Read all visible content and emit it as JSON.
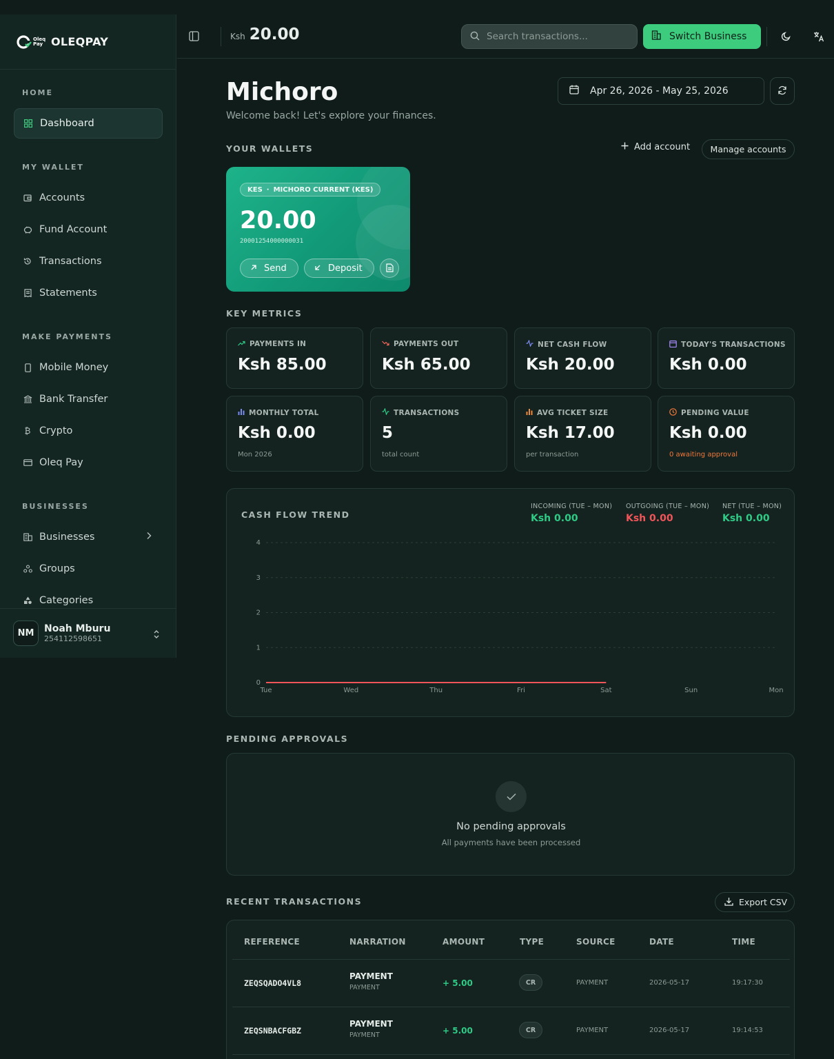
{
  "brand": {
    "logo_text": "Oleq Pay",
    "name": "OLEQPAY"
  },
  "sidebar": {
    "sections": [
      {
        "title": "HOME"
      },
      {
        "title": "MY WALLET"
      },
      {
        "title": "MAKE PAYMENTS"
      },
      {
        "title": "BUSINESSES"
      }
    ],
    "items": [
      {
        "label": "Dashboard",
        "icon": "grid-icon",
        "active": true
      },
      {
        "label": "Accounts",
        "icon": "wallet-icon"
      },
      {
        "label": "Fund Account",
        "icon": "piggy-bank-icon"
      },
      {
        "label": "Transactions",
        "icon": "history-icon"
      },
      {
        "label": "Statements",
        "icon": "receipt-icon"
      },
      {
        "label": "Mobile Money",
        "icon": "phone-icon"
      },
      {
        "label": "Bank Transfer",
        "icon": "bank-icon"
      },
      {
        "label": "Crypto",
        "icon": "bitcoin-icon"
      },
      {
        "label": "Oleq Pay",
        "icon": "card-icon"
      },
      {
        "label": "Businesses",
        "icon": "building-icon"
      },
      {
        "label": "Groups",
        "icon": "groups-icon"
      },
      {
        "label": "Categories",
        "icon": "shapes-icon"
      }
    ],
    "user": {
      "initials": "NM",
      "name": "Noah Mburu",
      "phone": "254112598651"
    }
  },
  "topbar": {
    "currency": "Ksh",
    "balance": "20.00",
    "search_placeholder": "Search transactions...",
    "switch_label": "Switch Business"
  },
  "page": {
    "title": "Michoro",
    "subtitle": "Welcome back! Let's explore your finances.",
    "date_range": "Apr 26, 2026 - May 25, 2026"
  },
  "wallets": {
    "section_title": "YOUR WALLETS",
    "add_label": "Add account",
    "manage_label": "Manage accounts",
    "card": {
      "currency": "KES",
      "name": "MICHORO CURRENT (KES)",
      "amount": "20.00",
      "number": "20001254000000031",
      "send_label": "Send",
      "deposit_label": "Deposit"
    }
  },
  "metrics": {
    "section_title": "KEY METRICS",
    "items": [
      {
        "label": "PAYMENTS IN",
        "value": "Ksh 85.00",
        "note": "",
        "icon": "trend-up-icon",
        "color": "#2fca86"
      },
      {
        "label": "PAYMENTS OUT",
        "value": "Ksh 65.00",
        "note": "",
        "icon": "trend-down-icon",
        "color": "#f0655a"
      },
      {
        "label": "NET CASH FLOW",
        "value": "Ksh 20.00",
        "note": "",
        "icon": "activity-icon",
        "color": "#7b8cf0"
      },
      {
        "label": "TODAY'S TRANSACTIONS",
        "value": "Ksh 0.00",
        "note": "",
        "icon": "calendar-icon",
        "color": "#a78bfa"
      },
      {
        "label": "MONTHLY TOTAL",
        "value": "Ksh 0.00",
        "note": "Mon 2026",
        "icon": "bar-chart-icon",
        "color": "#7b8cf0"
      },
      {
        "label": "TRANSACTIONS",
        "value": "5",
        "note": "total count",
        "icon": "pulse-icon",
        "color": "#2fca86"
      },
      {
        "label": "AVG TICKET SIZE",
        "value": "Ksh 17.00",
        "note": "per transaction",
        "icon": "bar-chart-icon",
        "color": "#f08a3c"
      },
      {
        "label": "PENDING VALUE",
        "value": "Ksh 0.00",
        "note": "0 awaiting approval",
        "icon": "clock-icon",
        "color": "#f0783c"
      }
    ]
  },
  "chart": {
    "title": "CASH FLOW TREND",
    "stats": [
      {
        "label": "INCOMING (TUE – MON)",
        "value": "Ksh 0.00",
        "color": "#2fca86"
      },
      {
        "label": "OUTGOING (TUE – MON)",
        "value": "Ksh 0.00",
        "color": "#f0555a"
      },
      {
        "label": "NET (TUE – MON)",
        "value": "Ksh 0.00",
        "color": "#2fca86"
      }
    ]
  },
  "chart_data": {
    "type": "line",
    "categories": [
      "Tue",
      "Wed",
      "Thu",
      "Fri",
      "Sat",
      "Sun",
      "Mon"
    ],
    "ylim": [
      0,
      4
    ],
    "yticks": [
      0,
      1,
      2,
      3,
      4
    ],
    "grid": true,
    "series": [
      {
        "name": "",
        "values": [
          0,
          0,
          0,
          0,
          0,
          null,
          null
        ],
        "color": "#f0555a"
      }
    ]
  },
  "pending": {
    "section_title": "PENDING APPROVALS",
    "empty_title": "No pending approvals",
    "empty_sub": "All payments have been processed"
  },
  "transactions": {
    "section_title": "RECENT TRANSACTIONS",
    "export_label": "Export CSV",
    "columns": [
      "REFERENCE",
      "NARRATION",
      "AMOUNT",
      "TYPE",
      "SOURCE",
      "DATE",
      "TIME"
    ],
    "rows": [
      {
        "ref": "ZEQSQADO4VL8",
        "narration": "PAYMENT",
        "narration_sub": "PAYMENT",
        "amount": "+ 5.00",
        "type": "CR",
        "source": "PAYMENT",
        "date": "2026-05-17",
        "time": "19:17:30"
      },
      {
        "ref": "ZEQSNBACFGBZ",
        "narration": "PAYMENT",
        "narration_sub": "PAYMENT",
        "amount": "+ 5.00",
        "type": "CR",
        "source": "PAYMENT",
        "date": "2026-05-17",
        "time": "19:14:53"
      }
    ]
  }
}
